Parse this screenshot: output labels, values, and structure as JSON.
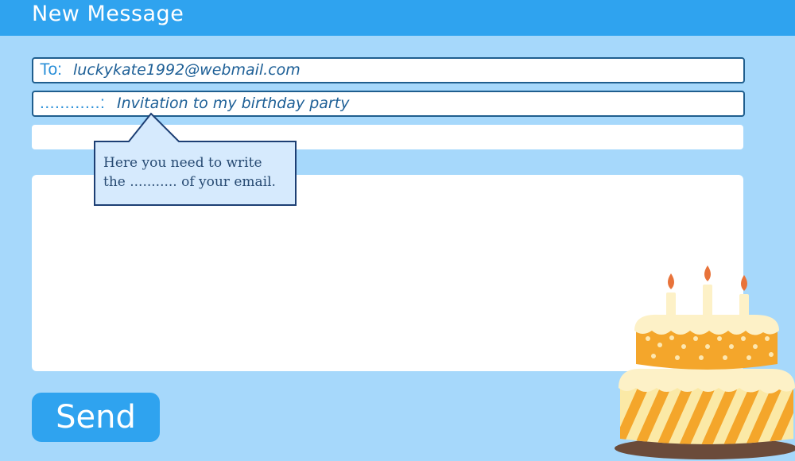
{
  "window": {
    "title": "New Message"
  },
  "to_field": {
    "label": "To:",
    "value": "luckykate1992@webmail.com"
  },
  "subject_field": {
    "label": "............:",
    "value": "Invitation to my birthday party"
  },
  "tooltip": {
    "line1": "Here you need to write",
    "line2": "the ........... of your email."
  },
  "actions": {
    "send_label": "Send"
  },
  "colors": {
    "background": "#a6d8fb",
    "title_bar": "#2fa3ef",
    "send_button": "#2fa3ef",
    "field_border": "#1f5e8e",
    "tooltip_fill": "#d6eafd",
    "tooltip_border": "#1d3f74"
  },
  "decorations": {
    "illustration": "birthday-cake-icon"
  }
}
